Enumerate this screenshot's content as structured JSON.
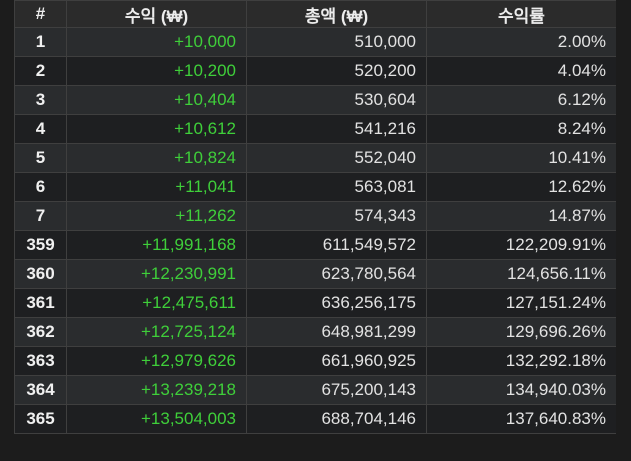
{
  "headers": [
    "#",
    "수익 (₩)",
    "총액 (₩)",
    "수익률"
  ],
  "rows": [
    {
      "idx": "1",
      "profit": "+10,000",
      "total": "510,000",
      "rate": "2.00%"
    },
    {
      "idx": "2",
      "profit": "+10,200",
      "total": "520,200",
      "rate": "4.04%"
    },
    {
      "idx": "3",
      "profit": "+10,404",
      "total": "530,604",
      "rate": "6.12%"
    },
    {
      "idx": "4",
      "profit": "+10,612",
      "total": "541,216",
      "rate": "8.24%"
    },
    {
      "idx": "5",
      "profit": "+10,824",
      "total": "552,040",
      "rate": "10.41%"
    },
    {
      "idx": "6",
      "profit": "+11,041",
      "total": "563,081",
      "rate": "12.62%"
    },
    {
      "idx": "7",
      "profit": "+11,262",
      "total": "574,343",
      "rate": "14.87%"
    },
    {
      "idx": "359",
      "profit": "+11,991,168",
      "total": "611,549,572",
      "rate": "122,209.91%"
    },
    {
      "idx": "360",
      "profit": "+12,230,991",
      "total": "623,780,564",
      "rate": "124,656.11%"
    },
    {
      "idx": "361",
      "profit": "+12,475,611",
      "total": "636,256,175",
      "rate": "127,151.24%"
    },
    {
      "idx": "362",
      "profit": "+12,725,124",
      "total": "648,981,299",
      "rate": "129,696.26%"
    },
    {
      "idx": "363",
      "profit": "+12,979,626",
      "total": "661,960,925",
      "rate": "132,292.18%"
    },
    {
      "idx": "364",
      "profit": "+13,239,218",
      "total": "675,200,143",
      "rate": "134,940.03%"
    },
    {
      "idx": "365",
      "profit": "+13,504,003",
      "total": "688,704,146",
      "rate": "137,640.83%"
    }
  ],
  "colors": {
    "profit": "#3fcf3a",
    "header_bg": "#2b2b2b",
    "row_odd": "#2a2c2e",
    "row_even": "#1e1f21",
    "border": "#3f3f3f"
  }
}
